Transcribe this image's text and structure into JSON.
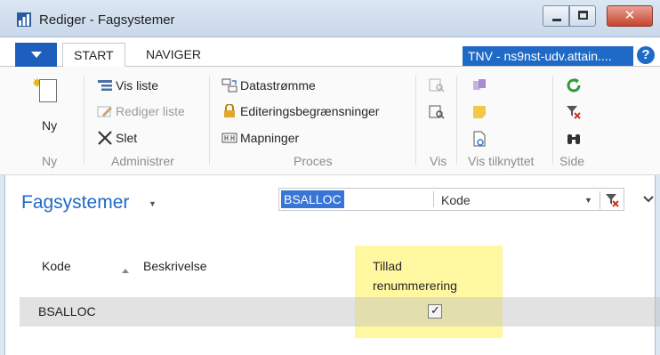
{
  "window": {
    "title": "Rediger - Fagsystemer"
  },
  "tabs": [
    {
      "label": "START",
      "active": true
    },
    {
      "label": "NAVIGER",
      "active": false
    }
  ],
  "company": "TNV - ns9nst-udv.attain....",
  "ribbon": {
    "ny": {
      "label": "Ny",
      "group": "Ny"
    },
    "administrer": {
      "group": "Administrer",
      "items": [
        "Vis liste",
        "Rediger liste",
        "Slet"
      ]
    },
    "proces": {
      "group": "Proces",
      "items": [
        "Datastrømme",
        "Editeringsbegrænsninger",
        "Mapninger"
      ]
    },
    "vis": {
      "group": "Vis"
    },
    "vis_tilknyttet": {
      "group": "Vis tilknyttet"
    },
    "side": {
      "group": "Side"
    }
  },
  "page": {
    "title": "Fagsystemer",
    "filter_value": "BSALLOC",
    "filter_field": "Kode"
  },
  "table": {
    "columns": [
      "Kode",
      "Beskrivelse",
      "Tillad",
      "renummerering"
    ],
    "rows": [
      {
        "kode": "BSALLOC",
        "beskrivelse": "",
        "tillad_renummerering": true
      }
    ]
  },
  "colors": {
    "accent": "#1e6ac6",
    "highlight": "#fff8a0",
    "selection": "#3875d7"
  }
}
